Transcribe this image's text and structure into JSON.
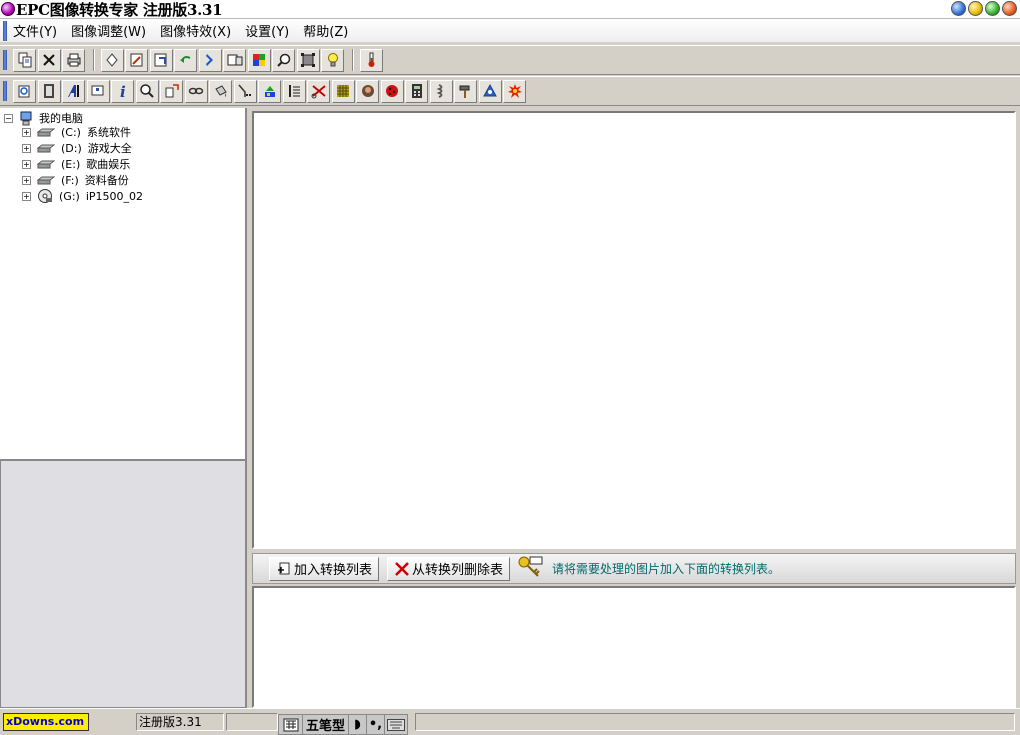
{
  "window": {
    "title": "EPC图像转换专家 注册版3.31"
  },
  "menu": {
    "items": [
      "文件(Y)",
      "图像调整(W)",
      "图像特效(X)",
      "设置(Y)",
      "帮助(Z)"
    ]
  },
  "toolbar1": {
    "icons": [
      "copy-icon",
      "delete-icon",
      "print-icon",
      "rotate-free-icon",
      "crop-icon",
      "resize-icon",
      "undo-icon",
      "next-icon",
      "compare-icon",
      "color-icon",
      "zoom-magnifier-icon",
      "frame-icon",
      "light-icon",
      "thermometer-icon"
    ]
  },
  "toolbar2": {
    "icons": [
      "refresh-icon",
      "film-icon",
      "text-icon",
      "flag-icon",
      "info-icon",
      "search-icon",
      "flip-icon",
      "chain-icon",
      "bucket-icon",
      "filter-icon",
      "paint-icon",
      "list-icon",
      "scissors-icon",
      "mosaic-icon",
      "face-icon",
      "ladybug-icon",
      "calculator-icon",
      "spring-icon",
      "hammer-icon",
      "recycle-icon",
      "explosion-icon"
    ]
  },
  "tree": {
    "root": "我的电脑",
    "drives": [
      {
        "letter": "(C:)",
        "label": "系统软件",
        "icon": "hard-drive-icon"
      },
      {
        "letter": "(D:)",
        "label": "游戏大全",
        "icon": "hard-drive-icon"
      },
      {
        "letter": "(E:)",
        "label": "歌曲娱乐",
        "icon": "hard-drive-icon"
      },
      {
        "letter": "(F:)",
        "label": "资料备份",
        "icon": "hard-drive-icon"
      },
      {
        "letter": "(G:)",
        "label": "iP1500_02",
        "icon": "cd-drive-icon"
      }
    ]
  },
  "actions": {
    "add_label": "加入转换列表",
    "remove_label": "从转换列删除表",
    "hint": "请将需要处理的图片加入下面的转换列表。"
  },
  "status": {
    "brand": "xDowns.com",
    "version": "注册版3.31",
    "ime_mode": "五笔型"
  },
  "colors": {
    "hint_text": "#006a6a",
    "brand_bg": "#ffee00",
    "brand_text": "#0000cc"
  }
}
